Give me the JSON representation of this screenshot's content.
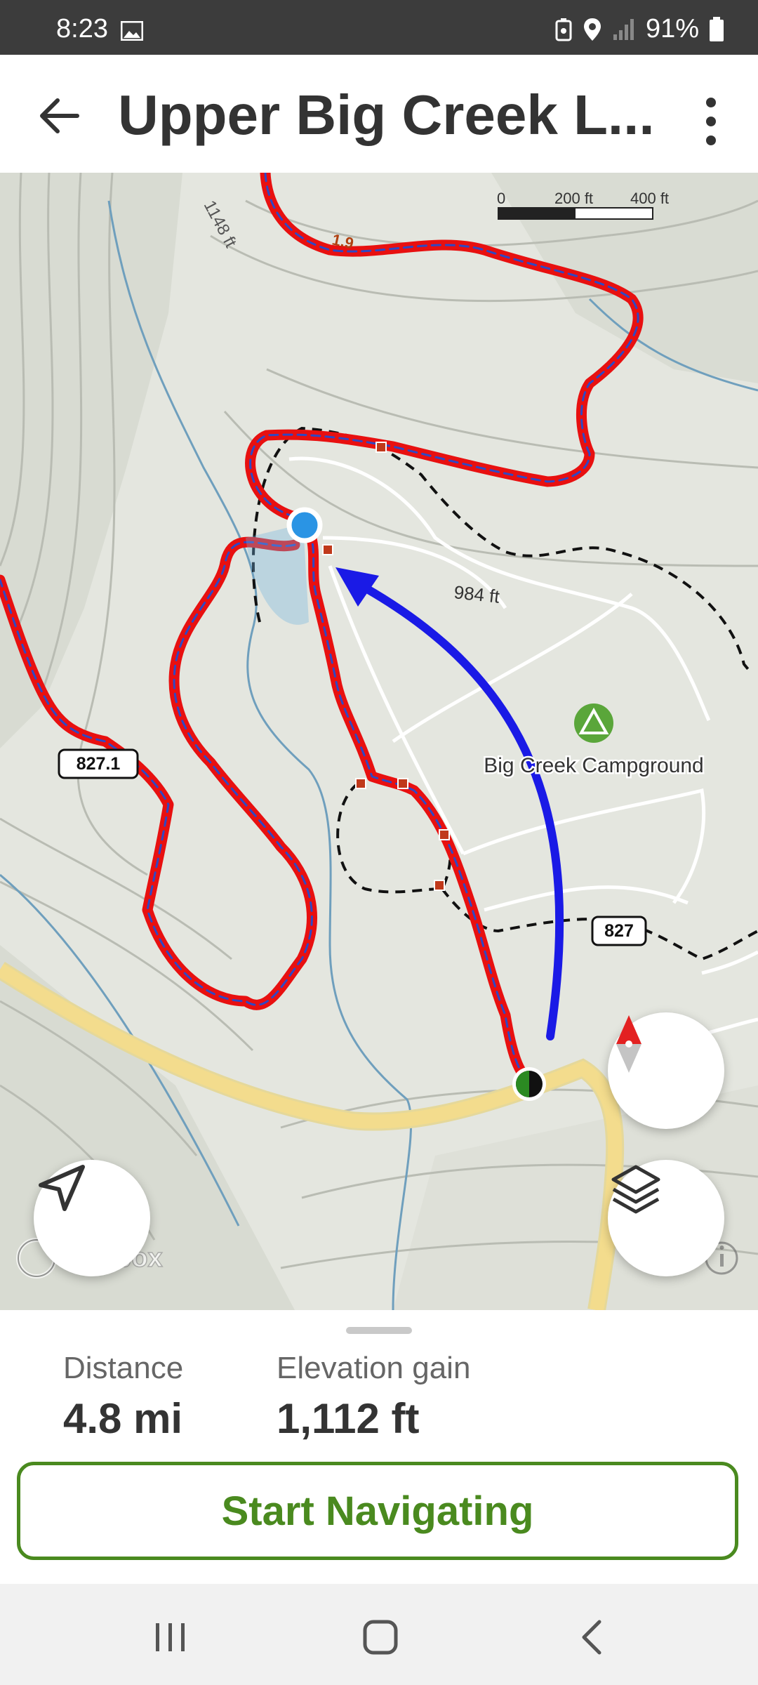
{
  "status_bar": {
    "time": "8:23",
    "battery": "91%",
    "icons": [
      "image-icon",
      "battery-saver-icon",
      "location-icon",
      "signal-icon",
      "battery-icon"
    ]
  },
  "header": {
    "title": "Upper Big Creek L...",
    "back_icon": "arrow-left-icon",
    "menu_icon": "more-vertical-icon"
  },
  "map": {
    "scale": {
      "zero": "0",
      "mid": "200 ft",
      "end": "400 ft"
    },
    "labels": {
      "elev_top": "1148 ft",
      "mile_marker": "1.9",
      "elev_mid": "984 ft",
      "campground": "Big Creek Campground",
      "road_left": "827.1",
      "road_right": "827"
    },
    "attribution": "mapbox",
    "colors": {
      "trail": "#e81010",
      "route_dash": "#2f48c4",
      "arrow": "#1a1ae6",
      "road": "#f3dc8d",
      "stream": "#6f9fbd",
      "park_green": "#5aa63a"
    }
  },
  "buttons": {
    "locate_icon": "navigation-arrow-icon",
    "compass_icon": "compass-icon",
    "layers_icon": "layers-icon",
    "info_icon": "info-icon"
  },
  "stats": {
    "distance_label": "Distance",
    "distance_value": "4.8 mi",
    "elevation_label": "Elevation gain",
    "elevation_value": "1,112 ft"
  },
  "cta": {
    "start_label": "Start Navigating"
  },
  "system_nav": {
    "icons": [
      "recent-apps-icon",
      "home-icon",
      "back-icon"
    ]
  }
}
